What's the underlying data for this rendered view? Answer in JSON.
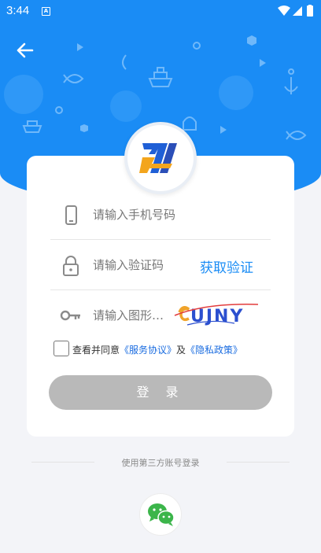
{
  "status_bar": {
    "time": "3:44",
    "app_icon_letter": "A"
  },
  "form": {
    "phone_placeholder": "请输入手机号码",
    "code_placeholder": "请输入验证码",
    "get_code_label": "获取验证",
    "image_code_placeholder": "请输入图形验证码",
    "captcha_text": "UJNY"
  },
  "agreement": {
    "prefix": "查看并同意",
    "service_link": "《服务协议》",
    "conjunction": "及",
    "privacy_link": "《隐私政策》",
    "checked": false
  },
  "login_label": "登 录",
  "third_party_label": "使用第三方账号登录",
  "icons": [
    "back-arrow-icon",
    "phone-icon",
    "lock-icon",
    "key-icon",
    "wechat-icon",
    "wifi-icon",
    "signal-icon",
    "battery-icon"
  ],
  "colors": {
    "primary": "#1a8cf5",
    "link": "#1a6ce0",
    "button_disabled": "#b9b9b9",
    "wechat": "#3bb54a"
  }
}
